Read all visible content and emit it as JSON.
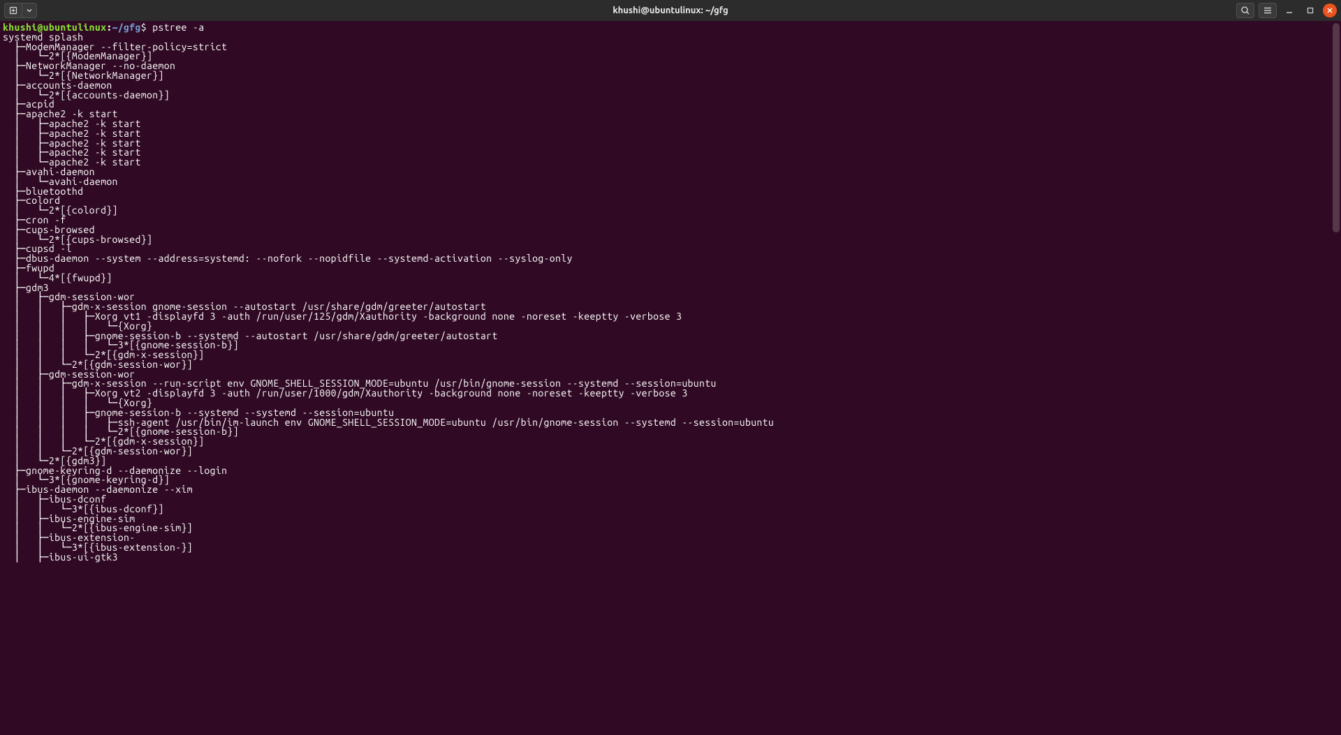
{
  "window": {
    "title": "khushi@ubuntulinux: ~/gfg"
  },
  "prompt": {
    "user_host": "khushi@ubuntulinux",
    "colon": ":",
    "path": "~/gfg",
    "symbol": "$",
    "command": " pstree -a"
  },
  "tree_lines": [
    "systemd splash",
    "  ├─ModemManager --filter-policy=strict",
    "  │   └─2*[{ModemManager}]",
    "  ├─NetworkManager --no-daemon",
    "  │   └─2*[{NetworkManager}]",
    "  ├─accounts-daemon",
    "  │   └─2*[{accounts-daemon}]",
    "  ├─acpid",
    "  ├─apache2 -k start",
    "  │   ├─apache2 -k start",
    "  │   ├─apache2 -k start",
    "  │   ├─apache2 -k start",
    "  │   ├─apache2 -k start",
    "  │   └─apache2 -k start",
    "  ├─avahi-daemon",
    "  │   └─avahi-daemon",
    "  ├─bluetoothd",
    "  ├─colord",
    "  │   └─2*[{colord}]",
    "  ├─cron -f",
    "  ├─cups-browsed",
    "  │   └─2*[{cups-browsed}]",
    "  ├─cupsd -l",
    "  ├─dbus-daemon --system --address=systemd: --nofork --nopidfile --systemd-activation --syslog-only",
    "  ├─fwupd",
    "  │   └─4*[{fwupd}]",
    "  ├─gdm3",
    "  │   ├─gdm-session-wor",
    "  │   │   ├─gdm-x-session gnome-session --autostart /usr/share/gdm/greeter/autostart",
    "  │   │   │   ├─Xorg vt1 -displayfd 3 -auth /run/user/125/gdm/Xauthority -background none -noreset -keeptty -verbose 3",
    "  │   │   │   │   └─{Xorg}",
    "  │   │   │   ├─gnome-session-b --systemd --autostart /usr/share/gdm/greeter/autostart",
    "  │   │   │   │   └─3*[{gnome-session-b}]",
    "  │   │   │   └─2*[{gdm-x-session}]",
    "  │   │   └─2*[{gdm-session-wor}]",
    "  │   ├─gdm-session-wor",
    "  │   │   ├─gdm-x-session --run-script env GNOME_SHELL_SESSION_MODE=ubuntu /usr/bin/gnome-session --systemd --session=ubuntu",
    "  │   │   │   ├─Xorg vt2 -displayfd 3 -auth /run/user/1000/gdm/Xauthority -background none -noreset -keeptty -verbose 3",
    "  │   │   │   │   └─{Xorg}",
    "  │   │   │   ├─gnome-session-b --systemd --systemd --session=ubuntu",
    "  │   │   │   │   ├─ssh-agent /usr/bin/im-launch env GNOME_SHELL_SESSION_MODE=ubuntu /usr/bin/gnome-session --systemd --session=ubuntu",
    "  │   │   │   │   └─2*[{gnome-session-b}]",
    "  │   │   │   └─2*[{gdm-x-session}]",
    "  │   │   └─2*[{gdm-session-wor}]",
    "  │   └─2*[{gdm3}]",
    "  ├─gnome-keyring-d --daemonize --login",
    "  │   └─3*[{gnome-keyring-d}]",
    "  ├─ibus-daemon --daemonize --xim",
    "  │   ├─ibus-dconf",
    "  │   │   └─3*[{ibus-dconf}]",
    "  │   ├─ibus-engine-sim",
    "  │   │   └─2*[{ibus-engine-sim}]",
    "  │   ├─ibus-extension-",
    "  │   │   └─3*[{ibus-extension-}]",
    "  │   ├─ibus-ui-gtk3"
  ]
}
